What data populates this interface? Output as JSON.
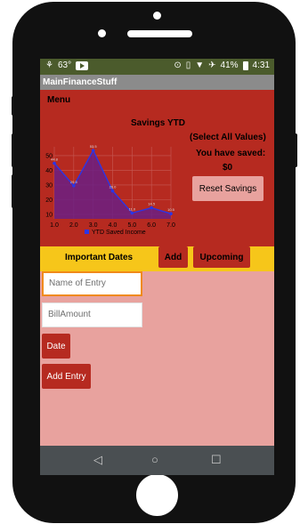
{
  "status_bar": {
    "temperature": "63°",
    "battery_percent": "41%",
    "time": "4:31"
  },
  "app": {
    "title": "MainFinanceStuff"
  },
  "menu_label": "Menu",
  "chart_data": {
    "type": "area",
    "title": "Savings YTD",
    "x": [
      1.0,
      2.0,
      3.0,
      4.0,
      5.0,
      6.0,
      7.0
    ],
    "xticks": [
      "1.0",
      "2.0",
      "3.0",
      "4.0",
      "5.0",
      "6.0",
      "7.0"
    ],
    "yticks": [
      "10",
      "20",
      "30",
      "40",
      "50"
    ],
    "series": [
      {
        "name": "YTD Saved Income",
        "values": [
          44.8,
          29.5,
          53.5,
          26.0,
          11.0,
          14.5,
          10.5
        ]
      }
    ],
    "point_labels": [
      "44.8",
      "29.5",
      "53.5",
      "26.0",
      "11.0",
      "14.5",
      "10.5"
    ],
    "xlim": [
      1.0,
      7.0
    ],
    "ylim": [
      7,
      56
    ],
    "grid": true,
    "legend_position": "bottom",
    "colors": {
      "fill": "#6b1f84",
      "line": "#2b35e6",
      "grid": "#c65a55"
    }
  },
  "savings": {
    "select_all": "(Select All Values)",
    "saved_label": "You have saved:",
    "amount": "$0",
    "reset_button": "Reset Savings"
  },
  "tabs": {
    "important_dates": "Important Dates",
    "add": "Add",
    "upcoming": "Upcoming"
  },
  "form": {
    "name_placeholder": "Name of Entry",
    "bill_placeholder": "BillAmount",
    "date_button": "Date",
    "add_entry_button": "Add Entry"
  },
  "nav": {
    "back_icon": "back-triangle-icon",
    "home_icon": "home-circle-icon",
    "recents_icon": "recents-square-icon"
  },
  "colors": {
    "red_panel": "#b62a20",
    "pink_bg": "#e8a29e",
    "yellow_bar": "#f6c61a",
    "status_green": "#4b5b2c"
  }
}
